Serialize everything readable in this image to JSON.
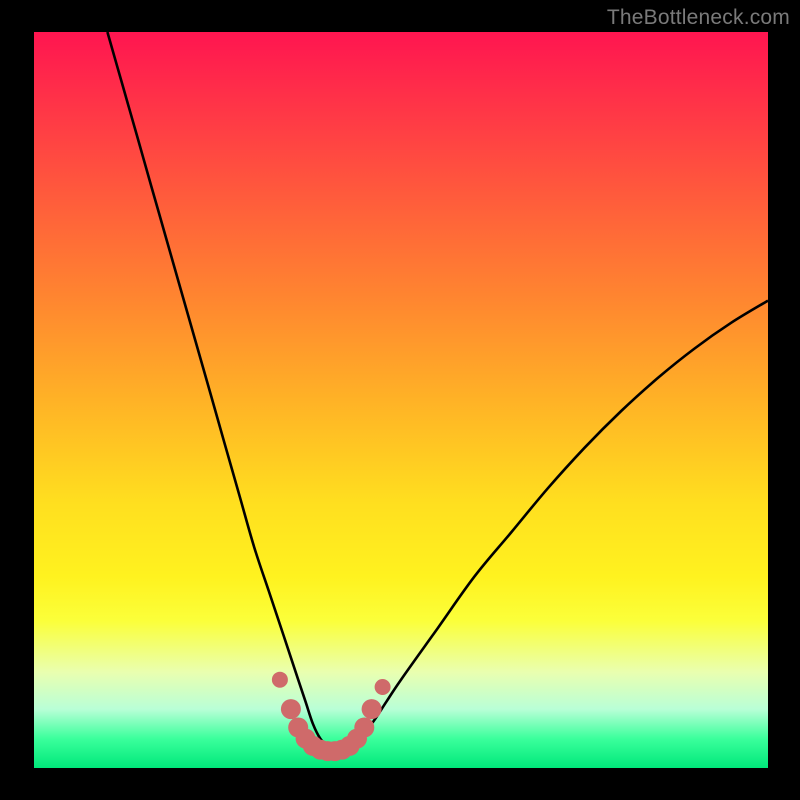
{
  "watermark": "TheBottleneck.com",
  "colors": {
    "background": "#000000",
    "curve": "#000000",
    "marker": "#cf6a6a",
    "gradient_top": "#ff1550",
    "gradient_bottom": "#00e87a"
  },
  "chart_data": {
    "type": "line",
    "title": "",
    "xlabel": "",
    "ylabel": "",
    "xlim": [
      0,
      100
    ],
    "ylim": [
      0,
      100
    ],
    "series": [
      {
        "name": "bottleneck-curve",
        "x": [
          10,
          12,
          14,
          16,
          18,
          20,
          22,
          24,
          26,
          28,
          30,
          32,
          34,
          36,
          37,
          38,
          39,
          40,
          41,
          42,
          43,
          44,
          46,
          48,
          50,
          55,
          60,
          65,
          70,
          75,
          80,
          85,
          90,
          95,
          100
        ],
        "y": [
          100,
          93,
          86,
          79,
          72,
          65,
          58,
          51,
          44,
          37,
          30,
          24,
          18,
          12,
          9,
          6,
          4,
          3,
          2.5,
          2.5,
          3,
          4,
          6,
          9,
          12,
          19,
          26,
          32,
          38,
          43.5,
          48.5,
          53,
          57,
          60.5,
          63.5
        ]
      }
    ],
    "markers": {
      "name": "highlight-points",
      "x": [
        33.5,
        35,
        36,
        37,
        38,
        39,
        40,
        41,
        42,
        43,
        44,
        45,
        46,
        47.5
      ],
      "y": [
        12,
        8,
        5.5,
        4,
        3,
        2.5,
        2.3,
        2.3,
        2.5,
        3,
        4,
        5.5,
        8,
        11
      ]
    }
  }
}
